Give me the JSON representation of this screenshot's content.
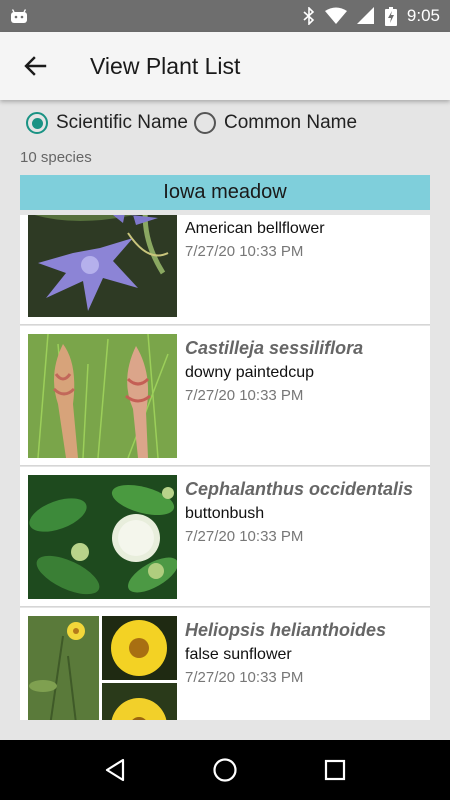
{
  "status_bar": {
    "time": "9:05",
    "icons": [
      "android-icon",
      "bluetooth-icon",
      "wifi-icon",
      "signal-icon",
      "battery-charging-icon"
    ]
  },
  "app_bar": {
    "title": "View Plant List",
    "back_icon": "arrow-left-icon"
  },
  "name_toggle": {
    "options": [
      {
        "label": "Scientific Name",
        "selected": true
      },
      {
        "label": "Common Name",
        "selected": false
      }
    ],
    "accent_color": "#1a9384"
  },
  "species_count": "10 species",
  "group": {
    "title": "Iowa meadow",
    "color": "#7fcfdb"
  },
  "plants": [
    {
      "scientific": "",
      "common": "American bellflower",
      "date": "7/27/20 10:33 PM"
    },
    {
      "scientific": "Castilleja sessiliflora",
      "common": "downy paintedcup",
      "date": "7/27/20 10:33 PM"
    },
    {
      "scientific": "Cephalanthus occidentalis",
      "common": "buttonbush",
      "date": "7/27/20 10:33 PM"
    },
    {
      "scientific": "Heliopsis helianthoides",
      "common": "false sunflower",
      "date": "7/27/20 10:33 PM"
    }
  ],
  "nav_bar": {
    "icons": [
      "back-triangle-icon",
      "home-circle-icon",
      "recents-square-icon"
    ]
  }
}
